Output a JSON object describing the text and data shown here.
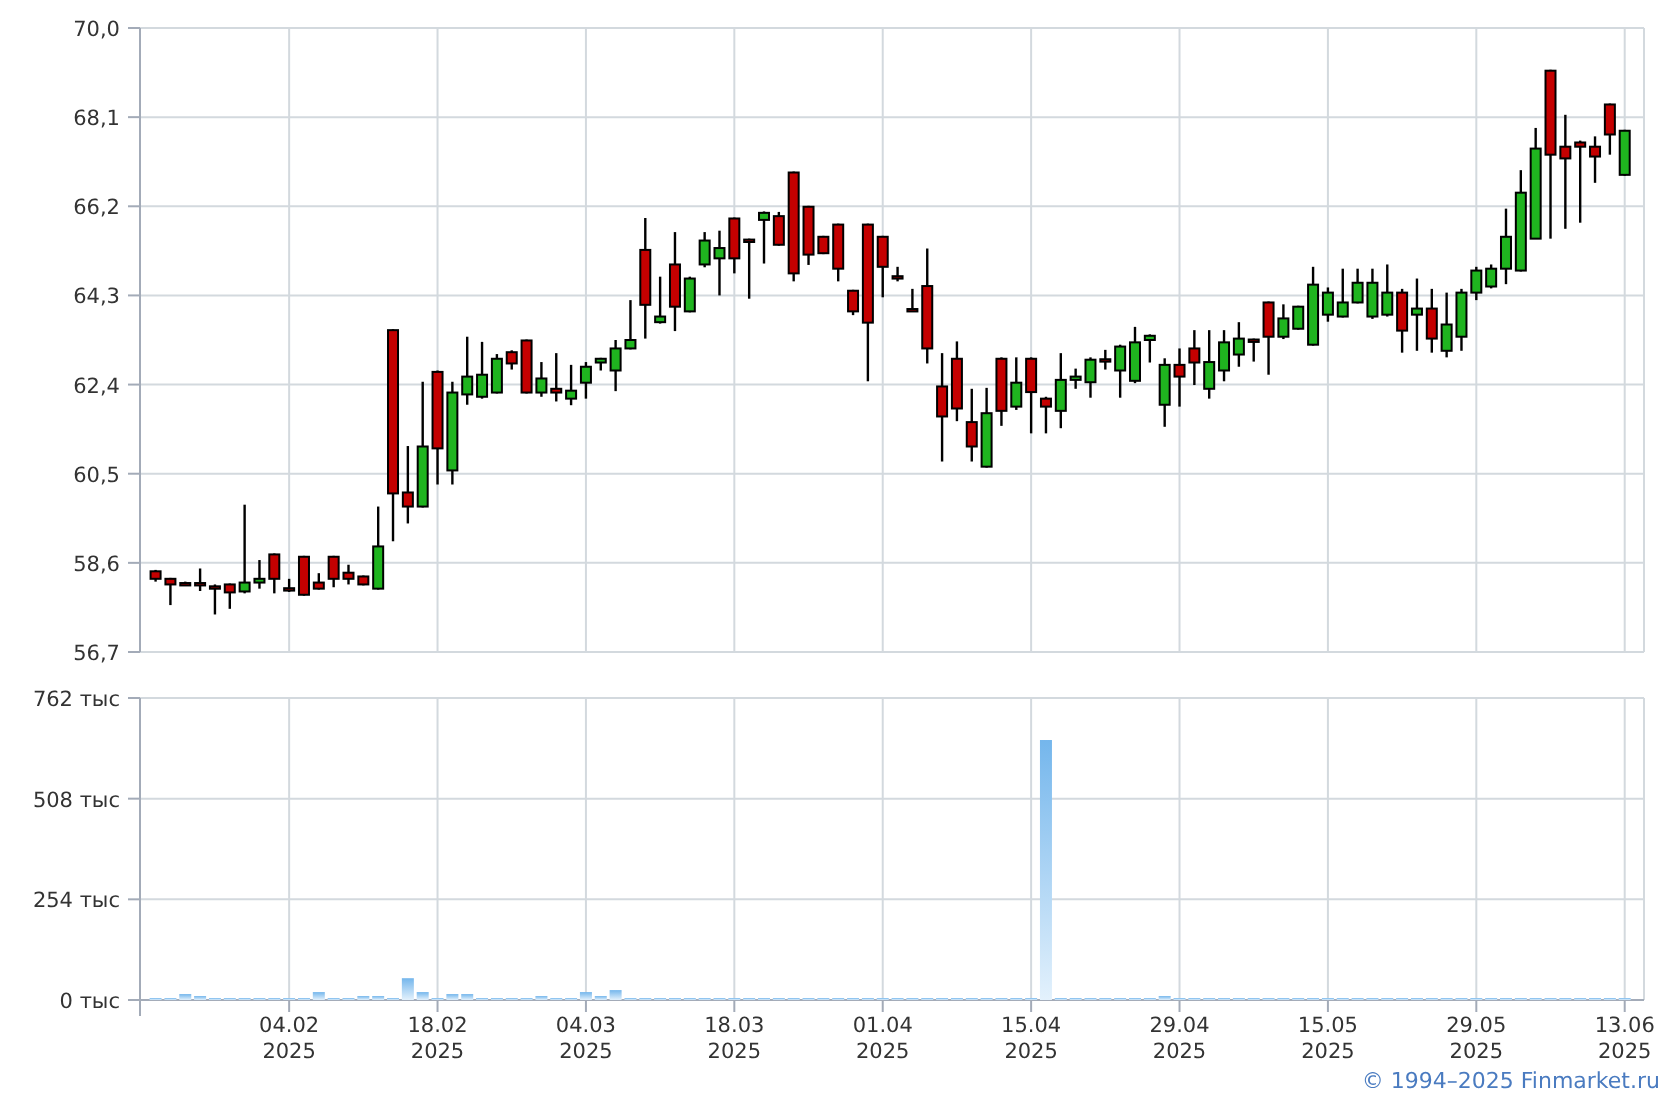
{
  "price_chart": {
    "chart_data": {
      "type": "candlestick",
      "grid": true,
      "ylim": [
        56.7,
        70.0
      ],
      "yticks": [
        {
          "value": 56.7,
          "label": "56,7"
        },
        {
          "value": 58.6,
          "label": "58,6"
        },
        {
          "value": 60.5,
          "label": "60,5"
        },
        {
          "value": 62.4,
          "label": "62,4"
        },
        {
          "value": 64.3,
          "label": "64,3"
        },
        {
          "value": 66.2,
          "label": "66,2"
        },
        {
          "value": 68.1,
          "label": "68,1"
        },
        {
          "value": 70.0,
          "label": "70,0"
        }
      ],
      "categories": [
        null,
        null,
        null,
        null,
        null,
        null,
        null,
        null,
        null,
        null,
        null,
        null,
        null,
        null,
        null,
        null,
        null,
        null,
        null,
        null,
        null,
        null,
        null,
        null,
        null,
        null,
        null,
        null,
        null,
        null,
        null,
        null,
        null,
        null,
        null,
        null,
        null,
        null,
        null,
        null,
        null,
        null,
        null,
        null,
        null,
        null,
        null,
        null,
        null,
        null,
        null,
        null,
        null,
        null,
        null,
        null,
        null,
        null,
        null,
        null,
        null,
        null,
        null,
        null,
        null,
        null,
        null,
        null,
        null,
        null,
        null,
        null,
        null,
        null,
        null,
        null,
        null,
        null,
        null,
        null,
        null,
        null,
        null,
        null,
        null,
        null,
        null,
        null,
        null,
        null,
        null,
        null,
        null,
        null,
        null,
        null,
        null,
        null,
        null,
        null
      ],
      "ohlc": [
        [
          58.42,
          58.45,
          58.2,
          58.26
        ],
        [
          58.26,
          58.28,
          57.7,
          58.14
        ],
        [
          58.17,
          58.2,
          58.12,
          58.16
        ],
        [
          58.17,
          58.48,
          58.0,
          58.16
        ],
        [
          58.1,
          58.14,
          57.5,
          58.09
        ],
        [
          58.14,
          58.16,
          57.62,
          57.97
        ],
        [
          57.99,
          59.84,
          57.95,
          58.18
        ],
        [
          58.18,
          58.66,
          58.05,
          58.26
        ],
        [
          58.78,
          58.8,
          57.95,
          58.26
        ],
        [
          58.06,
          58.26,
          57.98,
          58.05
        ],
        [
          58.73,
          58.75,
          57.9,
          57.92
        ],
        [
          58.18,
          58.38,
          58.03,
          58.05
        ],
        [
          58.73,
          58.75,
          58.08,
          58.26
        ],
        [
          58.39,
          58.56,
          58.14,
          58.26
        ],
        [
          58.31,
          58.33,
          58.12,
          58.14
        ],
        [
          58.05,
          59.8,
          58.03,
          58.95
        ],
        [
          63.56,
          63.58,
          59.06,
          60.08
        ],
        [
          60.1,
          61.09,
          59.44,
          59.8
        ],
        [
          59.8,
          62.46,
          59.78,
          61.08
        ],
        [
          62.67,
          62.7,
          60.27,
          61.04
        ],
        [
          60.57,
          62.46,
          60.27,
          62.23
        ],
        [
          62.19,
          63.42,
          61.97,
          62.57
        ],
        [
          62.14,
          63.31,
          62.1,
          62.61
        ],
        [
          62.23,
          63.05,
          62.21,
          62.95
        ],
        [
          63.09,
          63.13,
          62.72,
          62.85
        ],
        [
          63.34,
          63.36,
          62.21,
          62.23
        ],
        [
          62.23,
          62.88,
          62.14,
          62.53
        ],
        [
          62.31,
          63.07,
          62.04,
          62.23
        ],
        [
          62.1,
          62.82,
          61.96,
          62.27
        ],
        [
          62.44,
          62.88,
          62.1,
          62.78
        ],
        [
          62.87,
          62.97,
          62.7,
          62.95
        ],
        [
          62.7,
          63.35,
          62.26,
          63.17
        ],
        [
          63.17,
          64.2,
          63.15,
          63.35
        ],
        [
          65.27,
          65.95,
          63.38,
          64.1
        ],
        [
          63.73,
          64.7,
          63.7,
          63.85
        ],
        [
          64.96,
          65.65,
          63.54,
          64.06
        ],
        [
          63.96,
          64.7,
          63.94,
          64.66
        ],
        [
          64.96,
          65.65,
          64.9,
          65.47
        ],
        [
          65.09,
          65.68,
          64.3,
          65.31
        ],
        [
          65.94,
          65.96,
          64.77,
          65.09
        ],
        [
          65.49,
          65.51,
          64.23,
          65.48
        ],
        [
          65.91,
          66.09,
          64.98,
          66.06
        ],
        [
          65.99,
          66.08,
          65.36,
          65.38
        ],
        [
          66.92,
          66.94,
          64.6,
          64.77
        ],
        [
          66.19,
          66.21,
          64.95,
          65.17
        ],
        [
          65.55,
          65.57,
          65.18,
          65.2
        ],
        [
          65.81,
          65.83,
          64.6,
          64.87
        ],
        [
          64.4,
          64.42,
          63.88,
          63.96
        ],
        [
          65.81,
          65.83,
          62.47,
          63.72
        ],
        [
          65.55,
          65.57,
          64.26,
          64.91
        ],
        [
          64.71,
          64.91,
          64.6,
          64.7
        ],
        [
          64.01,
          64.44,
          63.95,
          64.0
        ],
        [
          64.5,
          65.3,
          62.85,
          63.17
        ],
        [
          62.36,
          63.07,
          60.76,
          61.72
        ],
        [
          62.95,
          63.32,
          61.62,
          61.89
        ],
        [
          61.6,
          62.31,
          60.76,
          61.08
        ],
        [
          60.65,
          62.33,
          60.63,
          61.79
        ],
        [
          62.95,
          62.98,
          61.52,
          61.84
        ],
        [
          61.93,
          62.98,
          61.86,
          62.44
        ],
        [
          62.95,
          62.98,
          61.36,
          62.24
        ],
        [
          62.1,
          62.14,
          61.36,
          61.93
        ],
        [
          61.84,
          63.07,
          61.47,
          62.5
        ],
        [
          62.5,
          62.74,
          62.31,
          62.57
        ],
        [
          62.45,
          62.98,
          62.12,
          62.93
        ],
        [
          62.94,
          63.14,
          62.72,
          62.93
        ],
        [
          62.7,
          63.25,
          62.12,
          63.21
        ],
        [
          62.48,
          63.63,
          62.43,
          63.3
        ],
        [
          63.35,
          63.47,
          62.87,
          63.44
        ],
        [
          61.97,
          62.96,
          61.5,
          62.82
        ],
        [
          62.82,
          63.17,
          61.93,
          62.57
        ],
        [
          63.17,
          63.56,
          62.39,
          62.87
        ],
        [
          62.31,
          63.56,
          62.1,
          62.88
        ],
        [
          62.7,
          63.56,
          62.47,
          63.3
        ],
        [
          63.04,
          63.73,
          62.78,
          63.38
        ],
        [
          63.36,
          63.38,
          62.89,
          63.35
        ],
        [
          64.15,
          64.17,
          62.61,
          63.42
        ],
        [
          63.42,
          64.11,
          63.37,
          63.81
        ],
        [
          63.59,
          64.08,
          63.57,
          64.06
        ],
        [
          63.25,
          64.91,
          63.23,
          64.53
        ],
        [
          63.89,
          64.47,
          63.74,
          64.36
        ],
        [
          63.85,
          64.87,
          63.83,
          64.15
        ],
        [
          64.15,
          64.87,
          64.13,
          64.57
        ],
        [
          63.85,
          64.87,
          63.8,
          64.57
        ],
        [
          63.89,
          64.96,
          63.85,
          64.36
        ],
        [
          64.36,
          64.44,
          63.08,
          63.55
        ],
        [
          63.89,
          64.66,
          63.12,
          64.02
        ],
        [
          64.02,
          64.44,
          63.08,
          63.38
        ],
        [
          63.12,
          64.36,
          62.98,
          63.68
        ],
        [
          63.42,
          64.44,
          63.12,
          64.36
        ],
        [
          64.36,
          64.91,
          64.2,
          64.83
        ],
        [
          64.49,
          64.96,
          64.45,
          64.87
        ],
        [
          64.87,
          66.15,
          64.54,
          65.55
        ],
        [
          64.83,
          66.97,
          64.81,
          66.49
        ],
        [
          65.51,
          67.87,
          65.51,
          67.43
        ],
        [
          69.09,
          69.11,
          65.51,
          67.3
        ],
        [
          67.47,
          68.15,
          65.72,
          67.22
        ],
        [
          67.56,
          67.6,
          65.85,
          67.47
        ],
        [
          67.47,
          67.69,
          66.7,
          67.26
        ],
        [
          68.37,
          68.39,
          67.3,
          67.73
        ],
        [
          66.87,
          67.83,
          66.85,
          67.81
        ]
      ]
    }
  },
  "volume_chart": {
    "chart_data": {
      "type": "bar",
      "grid": true,
      "ylim": [
        0,
        762
      ],
      "yticks": [
        {
          "value": 0,
          "label": "0 тыс"
        },
        {
          "value": 254,
          "label": "254 тыс"
        },
        {
          "value": 508,
          "label": "508 тыс"
        },
        {
          "value": 762,
          "label": "762 тыс"
        }
      ],
      "categories": [
        null,
        null,
        null,
        null,
        null,
        null,
        null,
        null,
        null,
        "04.02",
        null,
        null,
        null,
        null,
        null,
        null,
        null,
        null,
        null,
        "18.02",
        null,
        null,
        null,
        null,
        null,
        null,
        null,
        null,
        null,
        "04.03",
        null,
        null,
        null,
        null,
        null,
        null,
        null,
        null,
        null,
        "18.03",
        null,
        null,
        null,
        null,
        null,
        null,
        null,
        null,
        null,
        "01.04",
        null,
        null,
        null,
        null,
        null,
        null,
        null,
        null,
        null,
        "15.04",
        null,
        null,
        null,
        null,
        null,
        null,
        null,
        null,
        null,
        "29.04",
        null,
        null,
        null,
        null,
        null,
        null,
        null,
        null,
        null,
        "15.05",
        null,
        null,
        null,
        null,
        null,
        null,
        null,
        null,
        null,
        "29.05",
        null,
        null,
        null,
        null,
        null,
        null,
        null,
        null,
        null,
        "13.06"
      ],
      "values": [
        5,
        5,
        15,
        10,
        5,
        5,
        5,
        5,
        5,
        5,
        5,
        20,
        5,
        5,
        10,
        10,
        5,
        55,
        20,
        5,
        15,
        15,
        5,
        5,
        5,
        5,
        10,
        5,
        5,
        20,
        10,
        25,
        5,
        5,
        5,
        5,
        5,
        5,
        5,
        5,
        5,
        5,
        5,
        5,
        5,
        5,
        5,
        5,
        5,
        5,
        5,
        5,
        5,
        5,
        5,
        5,
        5,
        5,
        5,
        5,
        656,
        5,
        5,
        5,
        5,
        5,
        5,
        5,
        10,
        5,
        5,
        5,
        5,
        5,
        5,
        5,
        5,
        5,
        5,
        5,
        5,
        5,
        5,
        5,
        5,
        5,
        5,
        5,
        5,
        5,
        5,
        5,
        5,
        5,
        5,
        5,
        5,
        5,
        5,
        5
      ]
    },
    "xtick_years": [
      "2025",
      "2025",
      "2025",
      "2025",
      "2025",
      "2025",
      "2025",
      "2025",
      "2025",
      "2025"
    ]
  },
  "footer": {
    "copyright": "© 1994–2025 Finmarket.ru"
  }
}
